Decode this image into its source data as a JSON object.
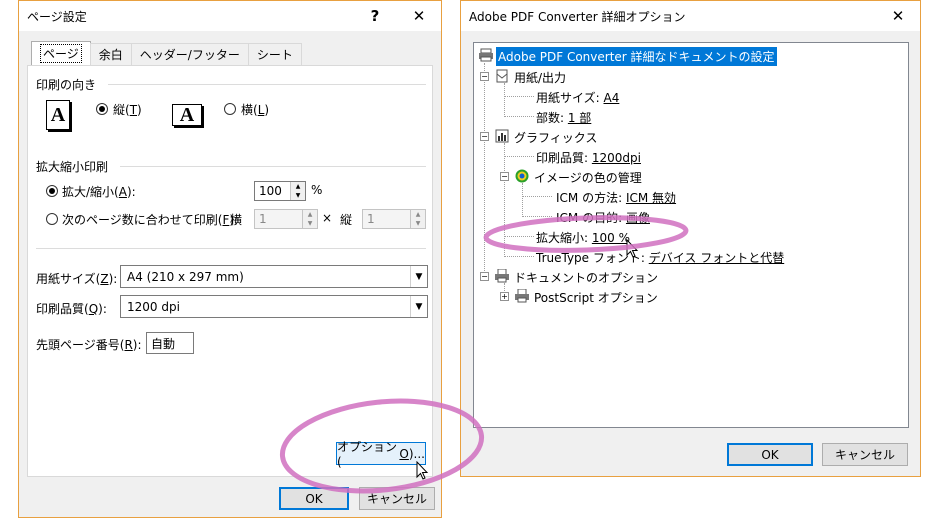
{
  "left_dialog": {
    "title": "ページ設定",
    "help_glyph": "?",
    "close_glyph": "✕",
    "tabs": [
      "ページ",
      "余白",
      "ヘッダー/フッター",
      "シート"
    ],
    "orientation": {
      "heading": "印刷の向き",
      "portrait_label": "縦(T)",
      "portrait_prefix": "縦(",
      "portrait_key": "T",
      "landscape_prefix": "横(",
      "landscape_key": "L",
      "icon_letter": "A"
    },
    "scaling": {
      "heading": "拡大縮小印刷",
      "adjust_prefix": "拡大/縮小(",
      "adjust_key": "A",
      "adjust_suffix": "):",
      "adjust_value": "100",
      "percent": "%",
      "fit_prefix": "次のページ数に合わせて印刷(",
      "fit_key": "F",
      "fit_suffix": "):",
      "wide_label": "横",
      "wide_value": "1",
      "times": "×",
      "tall_label": "縦",
      "tall_value": "1"
    },
    "paper_size": {
      "prefix": "用紙サイズ(",
      "key": "Z",
      "suffix": "):",
      "value": "A4 (210 x 297 mm)"
    },
    "print_quality": {
      "prefix": "印刷品質(",
      "key": "Q",
      "suffix": "):",
      "value": "1200 dpi"
    },
    "first_page": {
      "prefix": "先頭ページ番号(",
      "key": "R",
      "suffix": "):",
      "value": "自動"
    },
    "options_button": {
      "prefix": "オプション(",
      "key": "O",
      "suffix": ")..."
    },
    "ok_label": "OK",
    "cancel_label": "キャンセル"
  },
  "right_dialog": {
    "title": "Adobe PDF Converter 詳細オプション",
    "close_glyph": "✕",
    "tree": {
      "root": "Adobe PDF Converter 詳細なドキュメントの設定",
      "paper_output": "用紙/出力",
      "paper_size_label": "用紙サイズ: ",
      "paper_size_value": "A4",
      "copies_label": "部数: ",
      "copies_value": "1 部",
      "graphics": "グラフィックス",
      "print_quality_label": "印刷品質: ",
      "print_quality_value": "1200dpi",
      "image_color": "イメージの色の管理",
      "icm_method_label": "ICM の方法: ",
      "icm_method_value": "ICM 無効",
      "icm_intent_label": "ICM の目的: ",
      "icm_intent_value": "画像",
      "scaling_label": "拡大縮小: ",
      "scaling_value": "100 %",
      "truetype_label": "TrueType フォント: ",
      "truetype_value": "デバイス フォントと代替",
      "doc_options": "ドキュメントのオプション",
      "postscript": "PostScript オプション",
      "expand_minus": "−",
      "expand_plus": "+"
    },
    "ok_label": "OK",
    "cancel_label": "キャンセル"
  },
  "annotation_color": "#d070c0"
}
